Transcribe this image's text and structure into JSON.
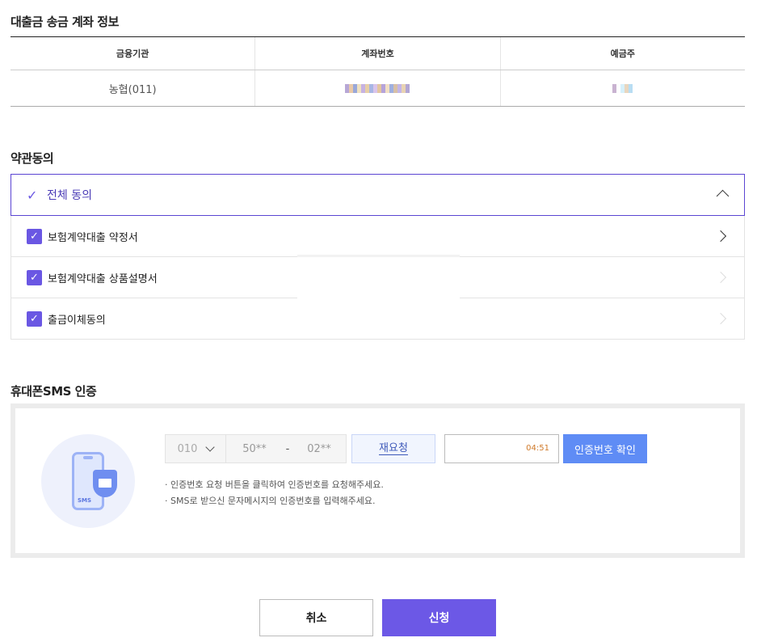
{
  "account_section": {
    "title": "대출금 송금 계좌 정보",
    "columns": [
      "금융기관",
      "계좌번호",
      "예금주"
    ],
    "row": {
      "institution": "농협(011)"
    }
  },
  "terms_section": {
    "title": "약관동의",
    "agree_all": {
      "label": "전체 동의",
      "checked": true,
      "expanded": true
    },
    "items": [
      {
        "label": "보험계약대출 약정서",
        "checked": true
      },
      {
        "label": "보험계약대출 상품설명서",
        "checked": true
      },
      {
        "label": "출금이체동의",
        "checked": true
      }
    ]
  },
  "sms_section": {
    "title": "휴대폰SMS 인증",
    "illustration_text": "SMS",
    "carrier_value": "010",
    "phone_middle": "50**",
    "phone_separator": "-",
    "phone_last": "02**",
    "resend_label": "재요청",
    "timer": "04:51",
    "confirm_label": "인증번호 확인",
    "notes": [
      "· 인증번호 요청 버튼을 클릭하여 인증번호를 요청해주세요.",
      "· SMS로 받으신 문자메시지의 인증번호를 입력해주세요."
    ]
  },
  "actions": {
    "cancel_label": "취소",
    "apply_label": "신청"
  },
  "colors": {
    "accent": "#6c58e6",
    "confirm": "#5f8cf5",
    "timer": "#d07a2a"
  },
  "icons": [
    "check-icon",
    "chevron-up-icon",
    "chevron-right-icon",
    "chevron-down-icon",
    "phone-shield-icon"
  ]
}
